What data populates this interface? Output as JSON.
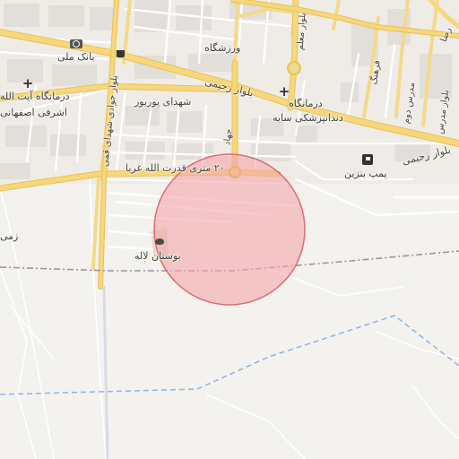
{
  "map": {
    "labels": {
      "boulevard_rahimi_west": "بلوار رحیمی",
      "boulevard_rahimi_east": "بلوار رحیمی",
      "bank_melli": "بانک ملی",
      "varzeshgah": "ورزشگاه",
      "clinic_ayatollah_1": "درمانگاه آیت الله",
      "clinic_ayatollah_2": "اشرفی اصفهانی",
      "shohada_pourbour": "شهدای پوربور",
      "clinic_dental_1": "درمانگاه",
      "clinic_dental_2": "دندانپزشکی سایه",
      "blvd_shohada_qomi": "بلوار جوادی شهدای قمی",
      "blvd_modarres": "بلوار مدرس",
      "blvd_moalem": "بلوار معلم",
      "farhang": "فرهنگ",
      "modarres_2": "مدرس دوم",
      "jahad_vertical": "جهاد",
      "reza": "رضا",
      "street_20m": "۲۰ متری قدرت الله غربا",
      "fuel_station": "پمپ بنزین",
      "park_laleh": "بوستان لاله",
      "zamin": "زمی"
    },
    "icons": [
      "bank-icon",
      "shop-icon",
      "hospital-icon",
      "fuel-icon",
      "park-icon",
      "roundabout-icon"
    ],
    "colors": {
      "background": "#f4f2ee",
      "road_major": "#f7d77a",
      "road_major_casing": "#e8c25a",
      "road_minor": "#ffffff",
      "building": "#e4e1dc",
      "green": "#c8e6c0",
      "circle_fill": "#f4a6ac",
      "circle_stroke": "#e06b76",
      "boundary": "#9a93a8",
      "waterway": "#90b6e6"
    }
  }
}
